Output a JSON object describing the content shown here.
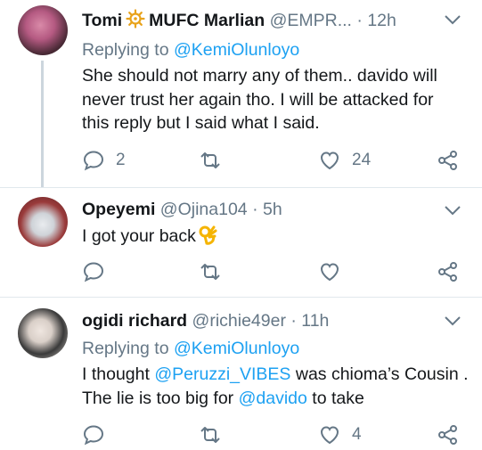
{
  "colors": {
    "accent": "#1da1f2",
    "muted": "#657786",
    "text": "#14171a",
    "divider": "#e1e8ed"
  },
  "tweets": [
    {
      "name": "Tomi",
      "name_suffix": "MUFC Marlian",
      "emoji_icon": "ship-wheel-icon",
      "handle": "@EMPR...",
      "dot": "·",
      "time": "12h",
      "replying_label": "Replying to",
      "replying_to": "@KemiOlunloyo",
      "text": "She should not marry any of them.. davido will never trust her again tho. I will be attacked for this reply but I said what I said.",
      "reply_count": "2",
      "retweet_count": "",
      "like_count": "24"
    },
    {
      "name": "Opeyemi",
      "handle": "@Ojina104",
      "dot": "·",
      "time": "5h",
      "text": "I got your back",
      "emoji_icon": "ok-hand-icon",
      "reply_count": "",
      "retweet_count": "",
      "like_count": ""
    },
    {
      "name": "ogidi richard",
      "handle": "@richie49er",
      "dot": "·",
      "time": "11h",
      "replying_label": "Replying to",
      "replying_to": "@KemiOlunloyo",
      "text_part1": "I thought ",
      "mention1": "@Peruzzi_VIBES",
      "text_part2": " was chioma’s Cousin . The lie is too big for ",
      "mention2": "@davido",
      "text_part3": " to take",
      "reply_count": "",
      "retweet_count": "",
      "like_count": "4"
    }
  ]
}
